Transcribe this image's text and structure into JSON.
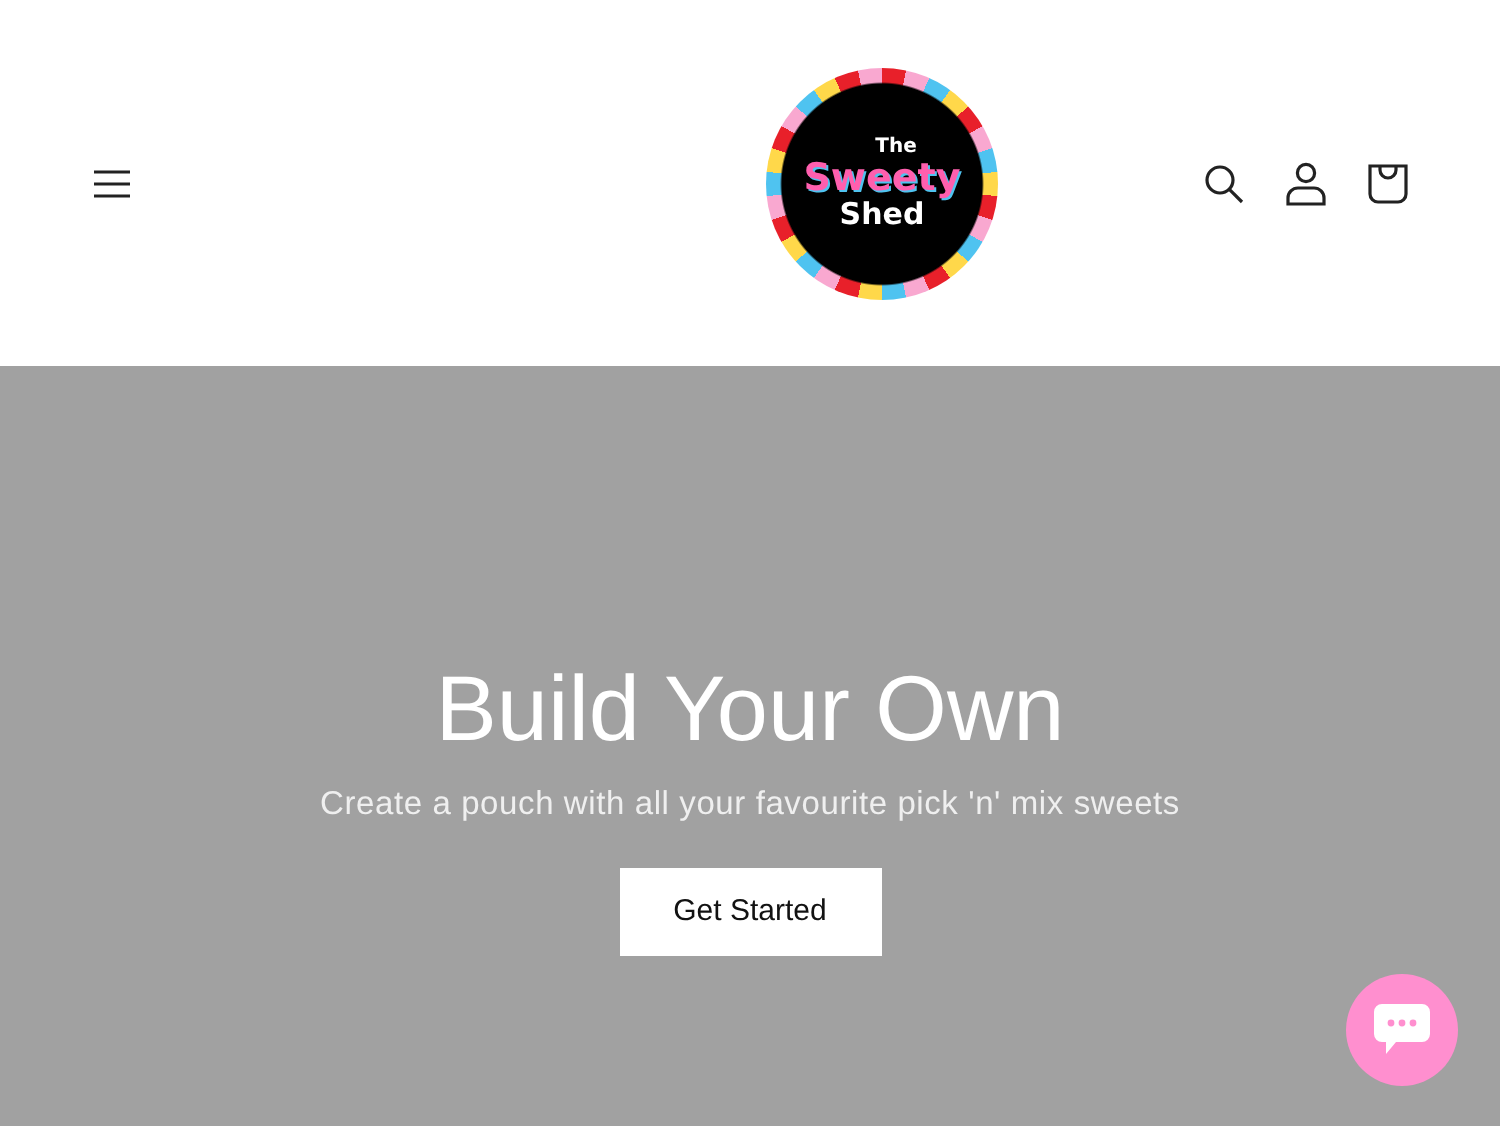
{
  "logo": {
    "lines": [
      {
        "kind": "small",
        "text": "The"
      },
      {
        "kind": "candy",
        "text": "Sweety"
      },
      {
        "kind": "plain",
        "text": "Shed"
      }
    ]
  },
  "hero": {
    "title": "Build Your Own",
    "subtitle": "Create a pouch with all your favourite pick 'n' mix sweets",
    "button": "Get Started"
  }
}
